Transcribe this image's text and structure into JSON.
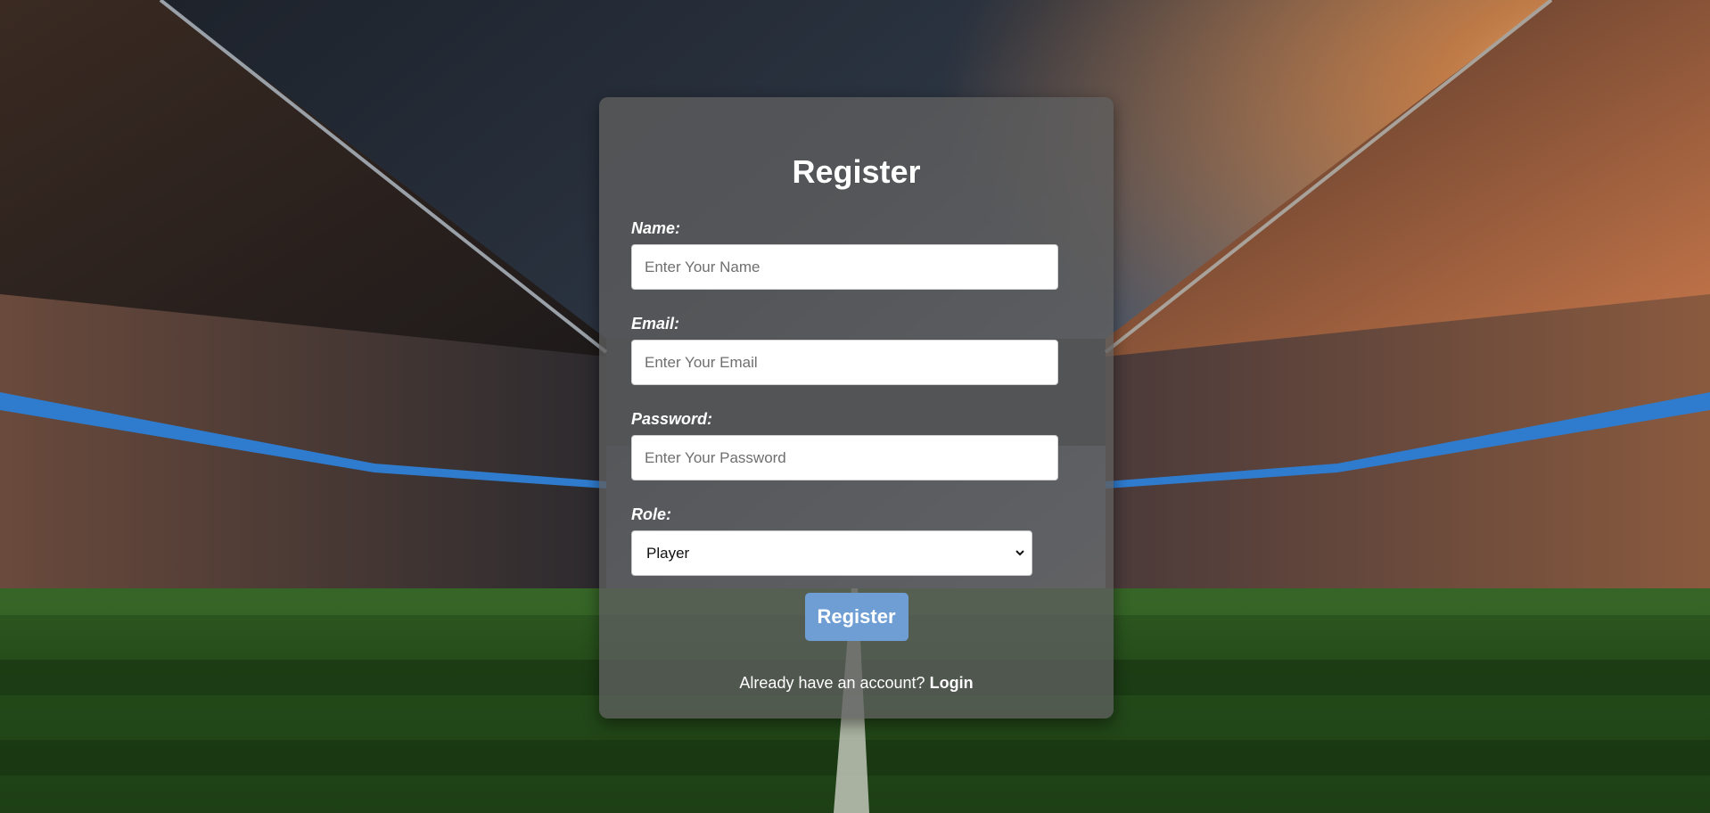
{
  "form": {
    "title": "Register",
    "name_label": "Name:",
    "name_placeholder": "Enter Your Name",
    "name_value": "",
    "email_label": "Email:",
    "email_placeholder": "Enter Your Email",
    "email_value": "",
    "password_label": "Password:",
    "password_placeholder": "Enter Your Password",
    "password_value": "",
    "role_label": "Role:",
    "role_selected": "Player",
    "submit_label": "Register",
    "login_prompt": "Already have an account?",
    "login_link": "Login"
  },
  "theme": {
    "card_background": "#5f5f5fc7",
    "button_color": "#6f9ed4",
    "text_color": "#ffffff"
  },
  "icons": {
    "select_chevron": "chevron-down-icon"
  }
}
